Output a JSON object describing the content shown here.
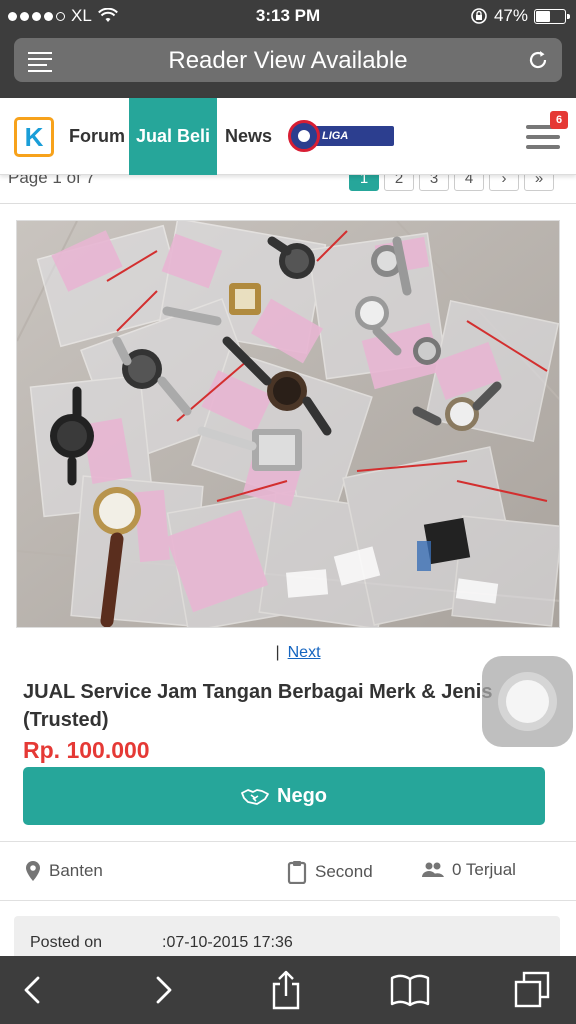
{
  "status_bar": {
    "carrier": "XL",
    "time": "3:13 PM",
    "battery": "47%",
    "battery_level": 0.47
  },
  "reader": {
    "title": "Reader View Available"
  },
  "site_nav": {
    "logo_letter": "K",
    "items": [
      {
        "label": "Forum"
      },
      {
        "label": "Jual Beli"
      },
      {
        "label": "News"
      }
    ],
    "liga_label": "LIGA INGGRIS",
    "notification_count": "6"
  },
  "pager": {
    "page_info": "Page 1 of 7",
    "pages": [
      "1",
      "2",
      "3",
      "4",
      "›",
      "»"
    ]
  },
  "listing": {
    "separator": "|",
    "next_label": "Next",
    "title": "JUAL Service Jam Tangan Berbagai Merk & Jenis (Trusted)",
    "price": "Rp. 100.000",
    "nego_label": "Nego",
    "location": "Banten",
    "condition": "Second",
    "sold": "0 Terjual",
    "posted_label": "Posted on",
    "posted_value": ":07-10-2015 17:36"
  },
  "colors": {
    "accent": "#26a69a",
    "price": "#e53935",
    "link": "#1565c0"
  },
  "icons": {
    "location": "map-pin-icon",
    "condition": "clipboard-icon",
    "sold": "people-icon",
    "nego": "handshake-icon"
  }
}
